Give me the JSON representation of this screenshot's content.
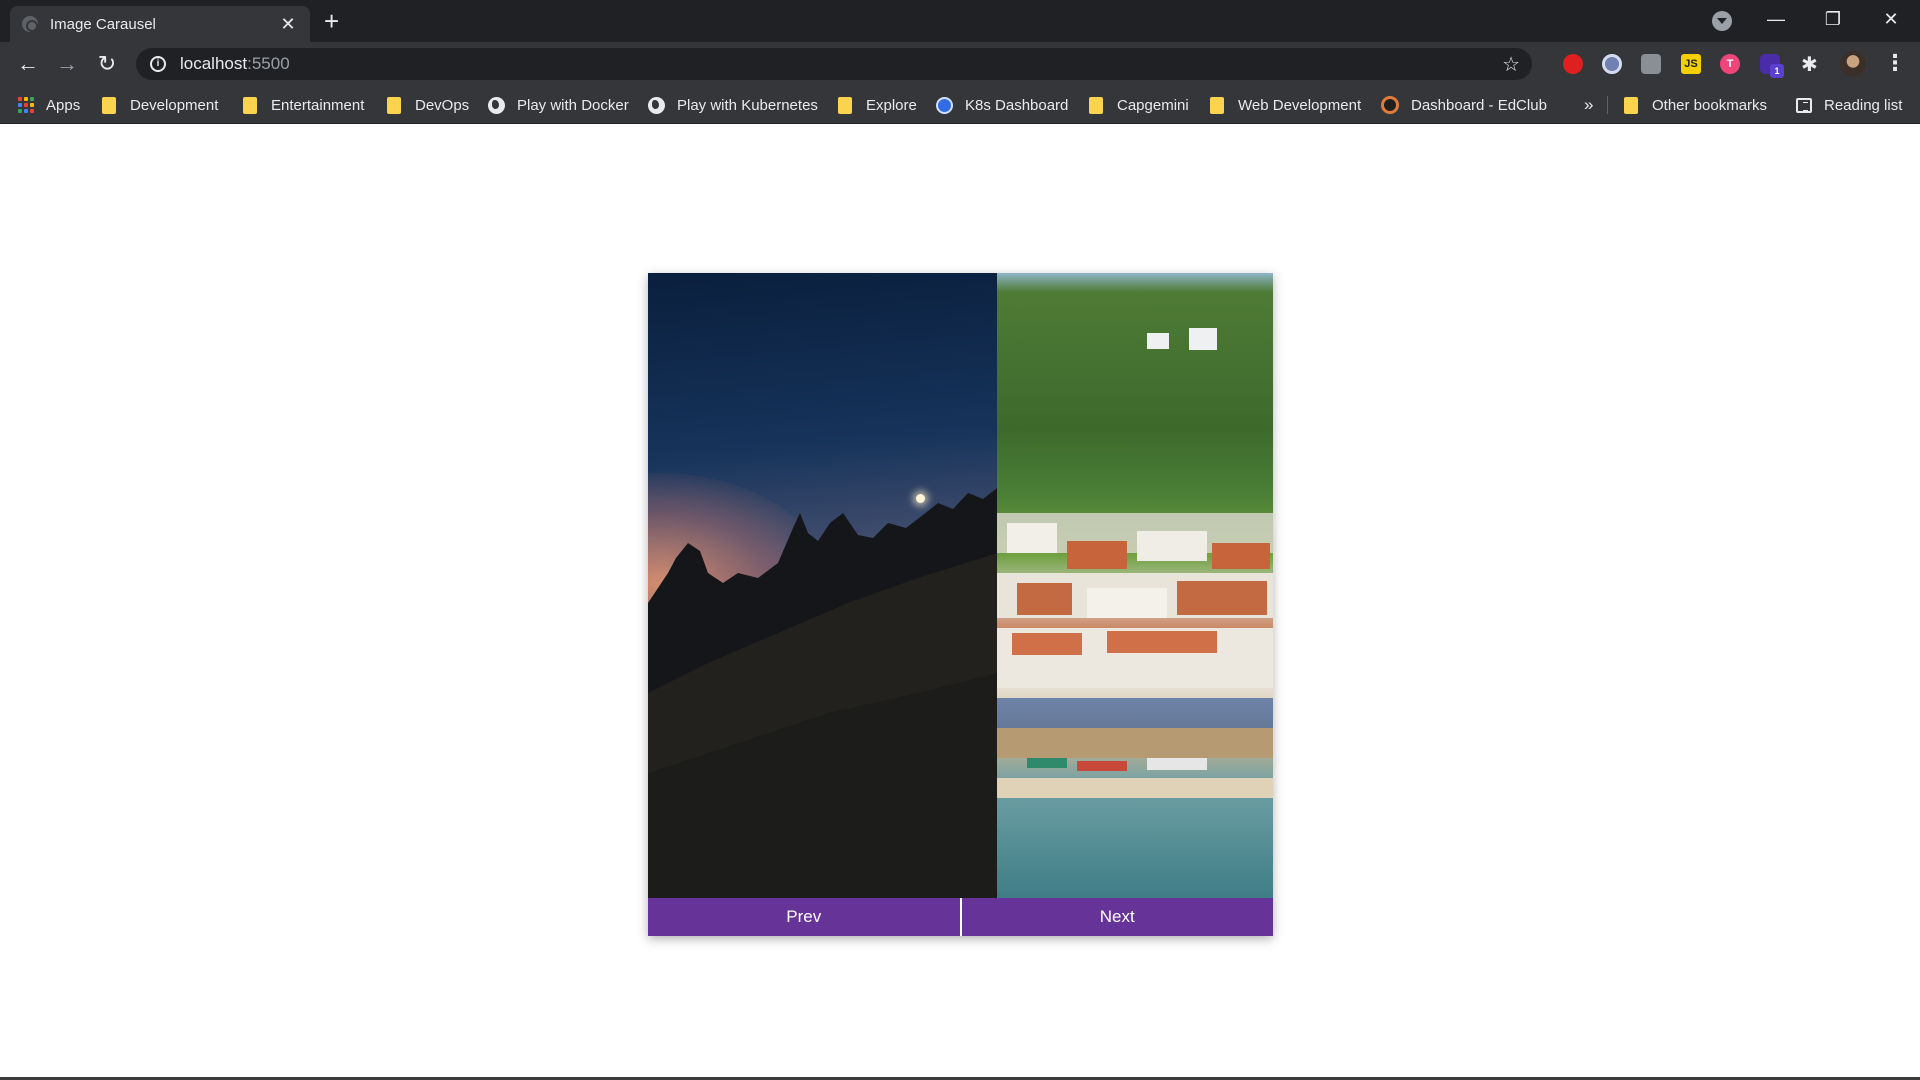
{
  "browser": {
    "tab": {
      "title": "Image Carausel",
      "close_glyph": "✕"
    },
    "new_tab_glyph": "+",
    "window_controls": {
      "minimize": "—",
      "maximize": "❐",
      "close": "✕"
    },
    "nav": {
      "back": "←",
      "forward": "→",
      "reload": "↻"
    },
    "address": {
      "host": "localhost",
      "port": ":5500"
    },
    "star_glyph": "☆",
    "menu_glyph": "⋮",
    "extension_badge": "1"
  },
  "bookmarks": {
    "apps": "Apps",
    "items": [
      "Development",
      "Entertainment",
      "DevOps",
      "Play with Docker",
      "Play with Kubernetes",
      "Explore",
      "K8s Dashboard",
      "Capgemini",
      "Web Development",
      "Dashboard - EdClub"
    ],
    "overflow_glyph": "»",
    "other": "Other bookmarks",
    "reading_list": "Reading list"
  },
  "carousel": {
    "images": [
      "night-hill-moon-photo",
      "seaside-village-photo"
    ],
    "prev_label": "Prev",
    "next_label": "Next",
    "accent_color": "#663399"
  }
}
